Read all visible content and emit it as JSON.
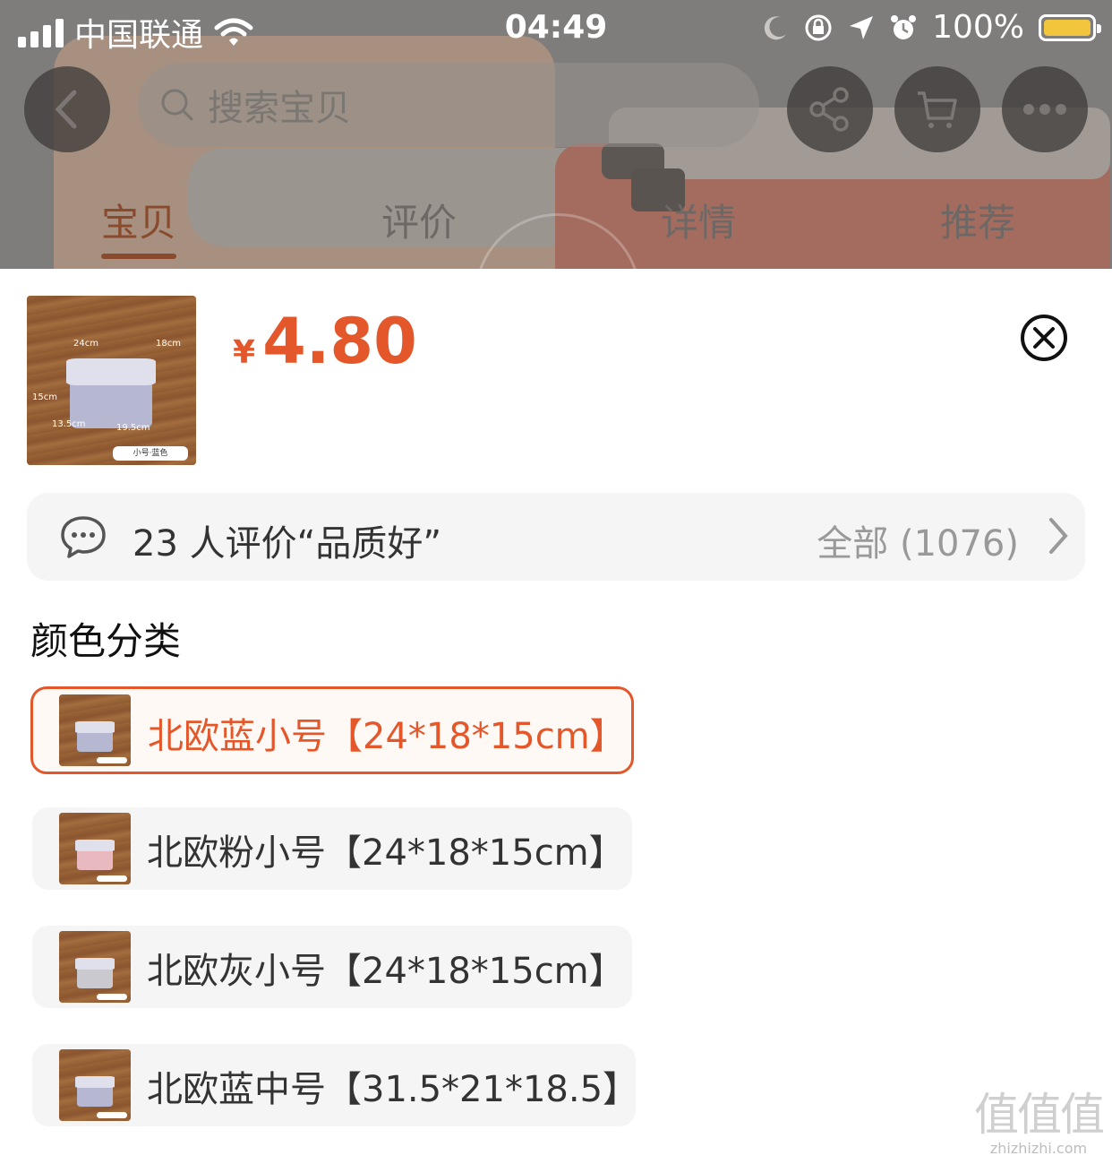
{
  "status_bar": {
    "carrier": "中国联通",
    "time": "04:49",
    "battery": "100%"
  },
  "header": {
    "search_placeholder": "搜索宝贝"
  },
  "tabs": [
    {
      "label": "宝贝",
      "active": true
    },
    {
      "label": "评价",
      "active": false
    },
    {
      "label": "详情",
      "active": false
    },
    {
      "label": "推荐",
      "active": false
    }
  ],
  "product": {
    "currency": "¥",
    "price": "4.80",
    "thumb": {
      "dims": [
        "24cm",
        "18cm",
        "15cm",
        "13.5cm",
        "19.5cm"
      ],
      "tag": "小号·蓝色"
    }
  },
  "review": {
    "summary": "23 人评价“品质好”",
    "all_label": "全部 (1076)"
  },
  "section": {
    "title": "颜色分类"
  },
  "options": [
    {
      "label": "北欧蓝小号【24*18*15cm】",
      "selected": true,
      "color": "#b6b8d1"
    },
    {
      "label": "北欧粉小号【24*18*15cm】",
      "selected": false,
      "color": "#e8b9bf"
    },
    {
      "label": "北欧灰小号【24*18*15cm】",
      "selected": false,
      "color": "#c9c9cf"
    },
    {
      "label": "北欧蓝中号【31.5*21*18.5】",
      "selected": false,
      "color": "#b6b8d1"
    }
  ],
  "colors": {
    "accent": "#e4572a",
    "sheet_bg": "#ffffff",
    "option_bg": "#f5f5f5"
  },
  "watermark": {
    "logo": "值值值",
    "site": "zhizhizhi.com"
  }
}
